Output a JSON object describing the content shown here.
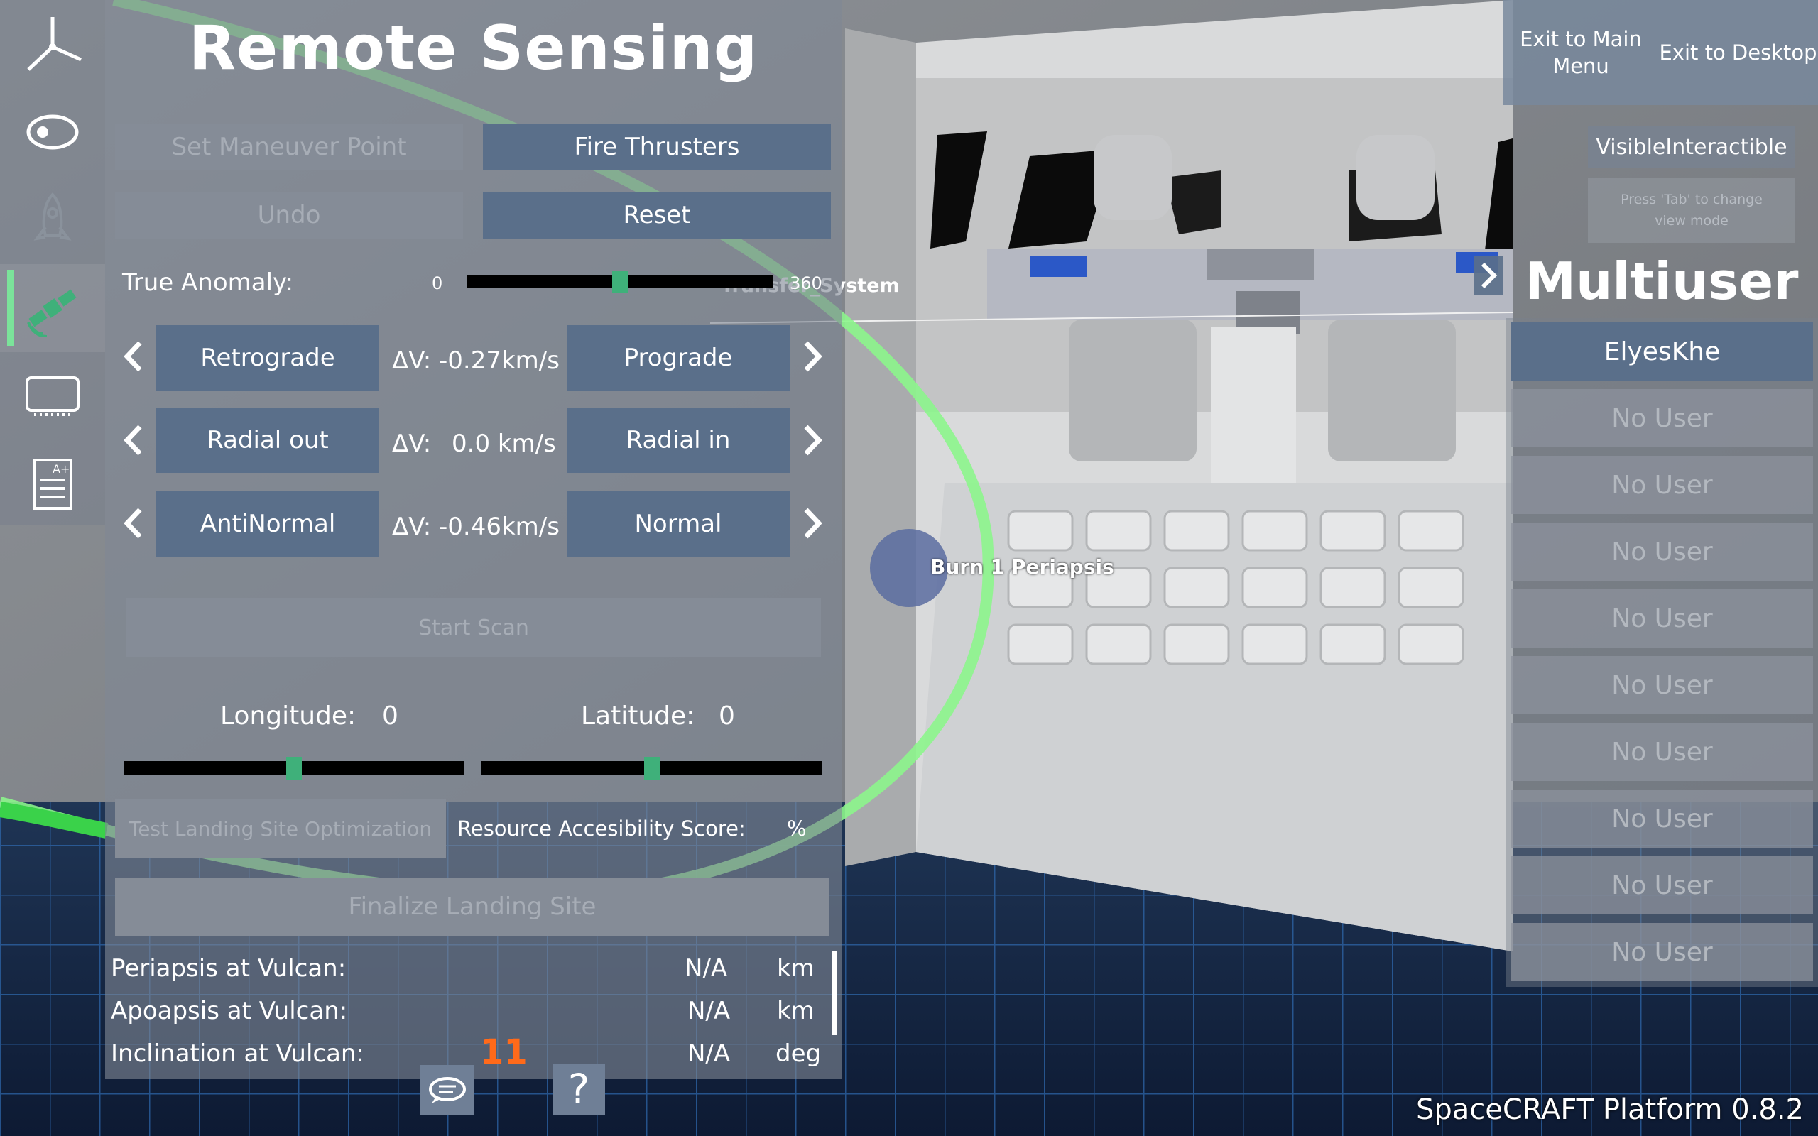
{
  "panel": {
    "title": "Remote Sensing",
    "buttons": {
      "set_maneuver_point": "Set Maneuver Point",
      "fire_thrusters": "Fire Thrusters",
      "undo": "Undo",
      "reset": "Reset",
      "start_scan": "Start Scan",
      "test_landing_site": "Test Landing Site Optimization",
      "finalize_landing_site": "Finalize Landing Site"
    },
    "true_anomaly": {
      "label": "True Anomaly:",
      "min": "0",
      "max": "360",
      "value_fraction": 0.5
    },
    "maneuvers": [
      {
        "left": "Retrograde",
        "dv_label": "ΔV:",
        "dv_value": "-0.27km/s",
        "right": "Prograde"
      },
      {
        "left": "Radial out",
        "dv_label": "ΔV:",
        "dv_value": "0.0 km/s",
        "right": "Radial in"
      },
      {
        "left": "AntiNormal",
        "dv_label": "ΔV:",
        "dv_value": "-0.46km/s",
        "right": "Normal"
      }
    ],
    "longitude": {
      "label": "Longitude:",
      "value": "0",
      "value_fraction": 0.5
    },
    "latitude": {
      "label": "Latitude:",
      "value": "0",
      "value_fraction": 0.5
    },
    "resource_score": {
      "label": "Resource Accesibility Score:",
      "unit": "%"
    },
    "orbit_stats": [
      {
        "label": "Periapsis at Vulcan:",
        "value": "N/A",
        "unit": "km"
      },
      {
        "label": "Apoapsis at Vulcan:",
        "value": "N/A",
        "unit": "km"
      },
      {
        "label": "Inclination at Vulcan:",
        "value": "N/A",
        "unit": "deg"
      }
    ],
    "chat_badge": "11"
  },
  "scene": {
    "label_transfer": "Transfer_System",
    "label_periapsis": "Burn 1 Periapsis"
  },
  "top_right": {
    "exit_main": "Exit to Main Menu",
    "exit_desktop": "Exit to Desktop",
    "mode": "VisibleInteractible",
    "mode_hint": "Press 'Tab' to change view mode"
  },
  "multiuser": {
    "title": "Multiuser",
    "users": [
      "ElyesKhe",
      "No User",
      "No User",
      "No User",
      "No User",
      "No User",
      "No User",
      "No User",
      "No User",
      "No User"
    ]
  },
  "version": "SpaceCRAFT Platform 0.8.2",
  "colors": {
    "accent_green": "#3fb07a",
    "button_blue": "#5a6f8a",
    "orbit_green": "#8cf58c"
  },
  "icons": [
    "axes-icon",
    "orbit-icon",
    "rocket-icon",
    "satellite-icon",
    "monitor-icon",
    "report-icon",
    "chat-icon",
    "help-icon"
  ]
}
